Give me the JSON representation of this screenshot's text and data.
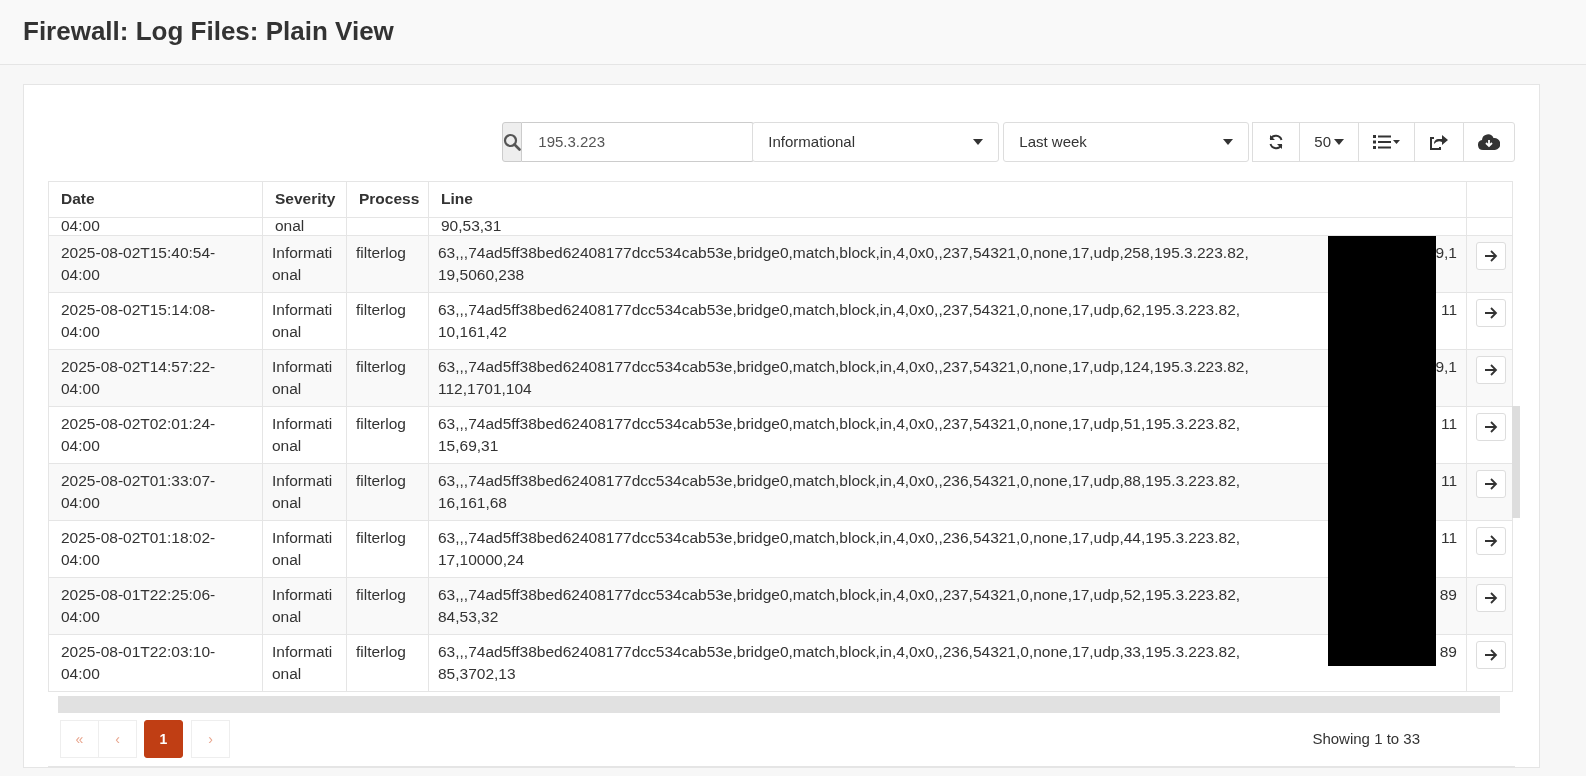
{
  "page": {
    "title": "Firewall: Log Files: Plain View"
  },
  "toolbar": {
    "search": {
      "value": "195.3.223"
    },
    "severity_filter": "Informational",
    "time_filter": "Last week",
    "page_size": "50"
  },
  "table": {
    "columns": [
      "Date",
      "Severity",
      "Process",
      "Line"
    ],
    "rows": [
      {
        "date": "04:00",
        "severity": "onal",
        "line_wrap": "90,53,31",
        "partial": true
      },
      {
        "date": "2025-08-02T15:40:54-04:00",
        "severity": "Informational",
        "process": "filterlog",
        "line": "63,,,74ad5ff38bed62408177dcc534cab53e,bridge0,match,block,in,4,0x0,,237,54321,0,none,17,udp,258,195.3.223.82,",
        "line_tail": "9,1",
        "line_wrap": "19,5060,238"
      },
      {
        "date": "2025-08-02T15:14:08-04:00",
        "severity": "Informational",
        "process": "filterlog",
        "line": "63,,,74ad5ff38bed62408177dcc534cab53e,bridge0,match,block,in,4,0x0,,237,54321,0,none,17,udp,62,195.3.223.82,",
        "line_tail": "11",
        "line_wrap": "10,161,42"
      },
      {
        "date": "2025-08-02T14:57:22-04:00",
        "severity": "Informational",
        "process": "filterlog",
        "line": "63,,,74ad5ff38bed62408177dcc534cab53e,bridge0,match,block,in,4,0x0,,237,54321,0,none,17,udp,124,195.3.223.82,",
        "line_tail": "9,1",
        "line_wrap": "112,1701,104"
      },
      {
        "date": "2025-08-02T02:01:24-04:00",
        "severity": "Informational",
        "process": "filterlog",
        "line": "63,,,74ad5ff38bed62408177dcc534cab53e,bridge0,match,block,in,4,0x0,,237,54321,0,none,17,udp,51,195.3.223.82,",
        "line_tail": "11",
        "line_wrap": "15,69,31"
      },
      {
        "date": "2025-08-02T01:33:07-04:00",
        "severity": "Informational",
        "process": "filterlog",
        "line": "63,,,74ad5ff38bed62408177dcc534cab53e,bridge0,match,block,in,4,0x0,,236,54321,0,none,17,udp,88,195.3.223.82,",
        "line_tail": "11",
        "line_wrap": "16,161,68"
      },
      {
        "date": "2025-08-02T01:18:02-04:00",
        "severity": "Informational",
        "process": "filterlog",
        "line": "63,,,74ad5ff38bed62408177dcc534cab53e,bridge0,match,block,in,4,0x0,,236,54321,0,none,17,udp,44,195.3.223.82,",
        "line_tail": "11",
        "line_wrap": "17,10000,24"
      },
      {
        "date": "2025-08-01T22:25:06-04:00",
        "severity": "Informational",
        "process": "filterlog",
        "line": "63,,,74ad5ff38bed62408177dcc534cab53e,bridge0,match,block,in,4,0x0,,237,54321,0,none,17,udp,52,195.3.223.82,",
        "line_tail": "89",
        "line_wrap": "84,53,32"
      },
      {
        "date": "2025-08-01T22:03:10-04:00",
        "severity": "Informational",
        "process": "filterlog",
        "line": "63,,,74ad5ff38bed62408177dcc534cab53e,bridge0,match,block,in,4,0x0,,236,54321,0,none,17,udp,33,195.3.223.82,",
        "line_tail": "89",
        "line_wrap": "85,3702,13"
      }
    ]
  },
  "pagination": {
    "pages": [
      {
        "label": "«",
        "disabled": true,
        "selected": false
      },
      {
        "label": "‹",
        "disabled": true,
        "selected": false
      },
      {
        "label": "1",
        "disabled": false,
        "selected": true
      },
      {
        "label": "›",
        "disabled": true,
        "selected": false
      }
    ],
    "status": "Showing 1 to 33"
  }
}
